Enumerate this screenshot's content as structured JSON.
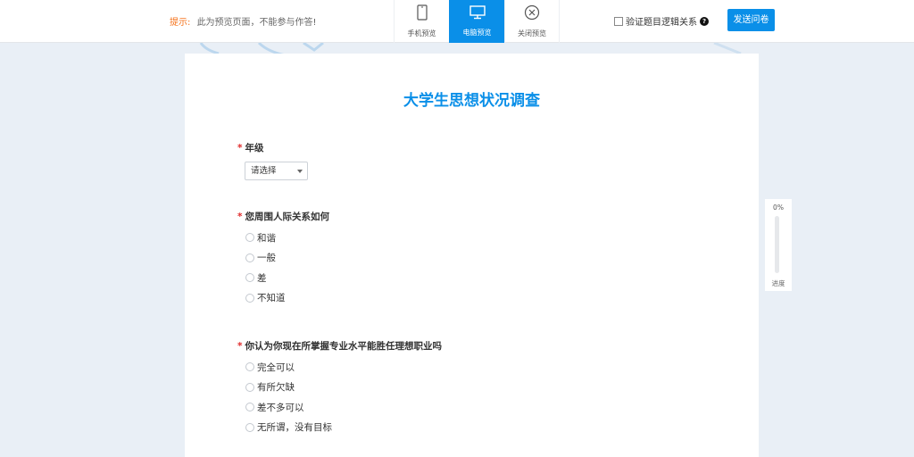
{
  "topbar": {
    "hint_label": "提示:",
    "hint_text": "此为预览页面，不能参与作答!",
    "modes": [
      {
        "label": "手机预览",
        "icon": "phone-icon",
        "active": false
      },
      {
        "label": "电脑预览",
        "icon": "monitor-icon",
        "active": true
      },
      {
        "label": "关闭预览",
        "icon": "close-circle-icon",
        "active": false
      }
    ],
    "logic_check_label": "验证题目逻辑关系",
    "help_icon_text": "?",
    "send_button": "发送问卷",
    "accent_color": "#0a8fe8"
  },
  "survey": {
    "title": "大学生思想状况调查",
    "questions": [
      {
        "required_mark": "*",
        "title": "年级",
        "type": "select",
        "select_value": "请选择"
      },
      {
        "required_mark": "*",
        "title": "您周围人际关系如何",
        "type": "radio",
        "options": [
          "和谐",
          "一般",
          "差",
          "不知道"
        ]
      },
      {
        "required_mark": "*",
        "title": "你认为你现在所掌握专业水平能胜任理想职业吗",
        "type": "radio",
        "options": [
          "完全可以",
          "有所欠缺",
          "差不多可以",
          "无所谓，没有目标"
        ]
      }
    ]
  },
  "progress": {
    "percent_text": "0%",
    "value": 0,
    "label": "进度"
  }
}
